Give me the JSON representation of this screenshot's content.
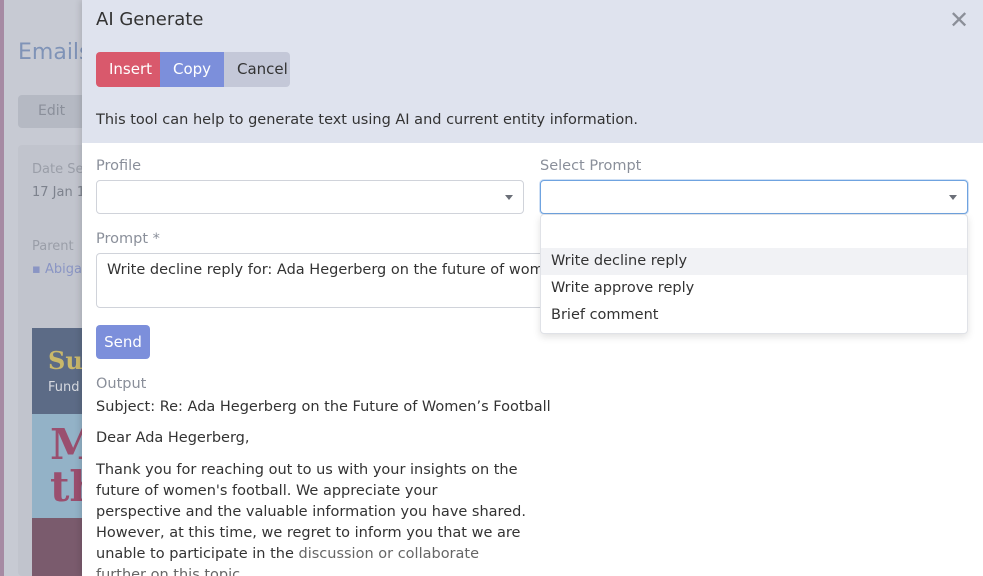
{
  "background": {
    "title": "Emails",
    "edit_label": "Edit",
    "date_label": "Date Se",
    "date_value": "17 Jan 1",
    "parent_label": "Parent",
    "parent_value": "Abiga",
    "thumb_text1": "Su",
    "thumb_text2": "Fund",
    "thumb_text3": "M\nth"
  },
  "modal": {
    "title": "AI Generate",
    "close_symbol": "✕",
    "buttons": {
      "insert": "Insert",
      "copy": "Copy",
      "cancel": "Cancel"
    },
    "description": "This tool can help to generate text using AI and current entity information.",
    "profile": {
      "label": "Profile",
      "value": ""
    },
    "select_prompt": {
      "label": "Select Prompt",
      "value": "",
      "search_value": "",
      "options": [
        "Write decline reply",
        "Write approve reply",
        "Brief comment"
      ]
    },
    "prompt": {
      "label": "Prompt *",
      "value": "Write decline reply for: Ada Hegerberg on the future of women’s football"
    },
    "send_label": "Send",
    "output": {
      "label": "Output",
      "subject": "Subject: Re: Ada Hegerberg on the Future of Women’s Football",
      "greeting": "Dear Ada Hegerberg,",
      "body_main": "Thank you for reaching out to us with your insights on the future of women's football. We appreciate your perspective and the valuable information you have shared. However, at this time, we regret to inform you that we are unable to participate in the ",
      "body_faded": "discussion or collaborate further on this topic."
    }
  },
  "colors": {
    "insert": "#d9596c",
    "copy": "#7c8fdb",
    "cancel": "#c4c8d8",
    "header_bg": "#dfe3ee",
    "focus_border": "#6fa3e0"
  }
}
